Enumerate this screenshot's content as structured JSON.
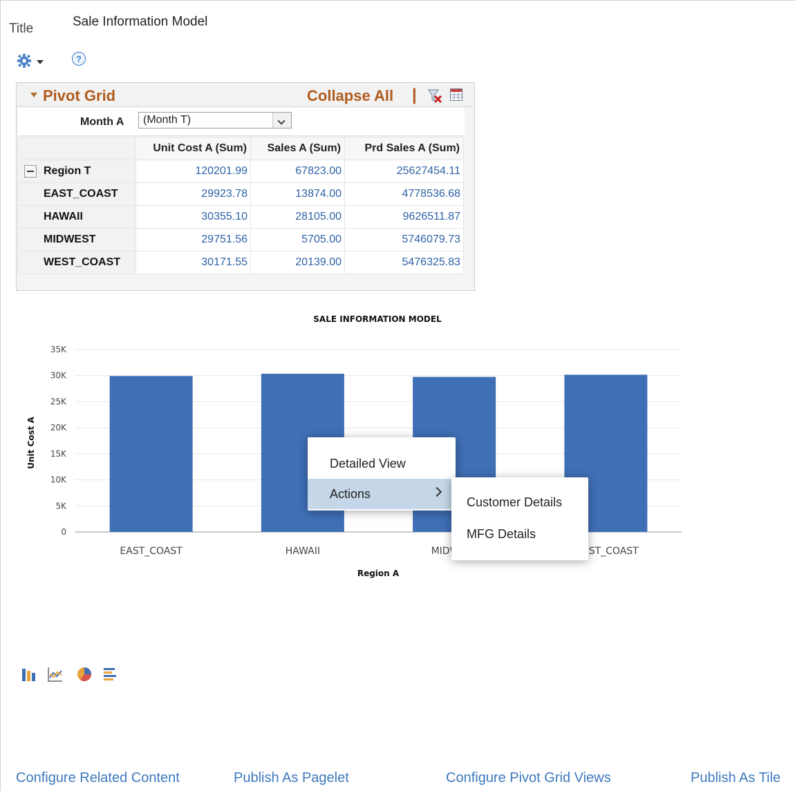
{
  "header": {
    "title_label": "Title",
    "title_value": "Sale Information Model"
  },
  "toolbar": {
    "settings_icon": "gear-icon",
    "help_text": "?"
  },
  "pivot": {
    "title": "Pivot Grid",
    "collapse_label": "Collapse All",
    "separator": "|",
    "month_label": "Month A",
    "month_value": "(Month T)",
    "columns": [
      "Unit Cost A (Sum)",
      "Sales A (Sum)",
      "Prd Sales A (Sum)"
    ],
    "rows": [
      {
        "label": "Region T",
        "values": [
          "120201.99",
          "67823.00",
          "25627454.11"
        ]
      },
      {
        "label": "EAST_COAST",
        "values": [
          "29923.78",
          "13874.00",
          "4778536.68"
        ]
      },
      {
        "label": "HAWAII",
        "values": [
          "30355.10",
          "28105.00",
          "9626511.87"
        ]
      },
      {
        "label": "MIDWEST",
        "values": [
          "29751.56",
          "5705.00",
          "5746079.73"
        ]
      },
      {
        "label": "WEST_COAST",
        "values": [
          "30171.55",
          "20139.00",
          "5476325.83"
        ]
      }
    ]
  },
  "chart_data": {
    "type": "bar",
    "title": "SALE INFORMATION MODEL",
    "xlabel": "Region A",
    "ylabel": "Unit Cost A",
    "categories": [
      "EAST_COAST",
      "HAWAII",
      "MIDWEST",
      "WEST_COAST"
    ],
    "values": [
      29923.78,
      30355.1,
      29751.56,
      30171.55
    ],
    "ylim": [
      0,
      35000
    ],
    "yticks": [
      "0",
      "5K",
      "10K",
      "15K",
      "20K",
      "25K",
      "30K",
      "35K"
    ],
    "color": "#3f6fb5",
    "grid": true
  },
  "context_menu": {
    "items": [
      "Detailed View",
      "Actions"
    ],
    "submenu": [
      "Customer Details",
      "MFG Details"
    ]
  },
  "chart_types": [
    "bar-chart-icon",
    "line-chart-icon",
    "pie-chart-icon",
    "horizontal-bar-chart-icon"
  ],
  "footer": {
    "links": [
      "Configure Related Content",
      "Publish As Pagelet",
      "Configure Pivot Grid Views",
      "Publish As Tile"
    ]
  }
}
